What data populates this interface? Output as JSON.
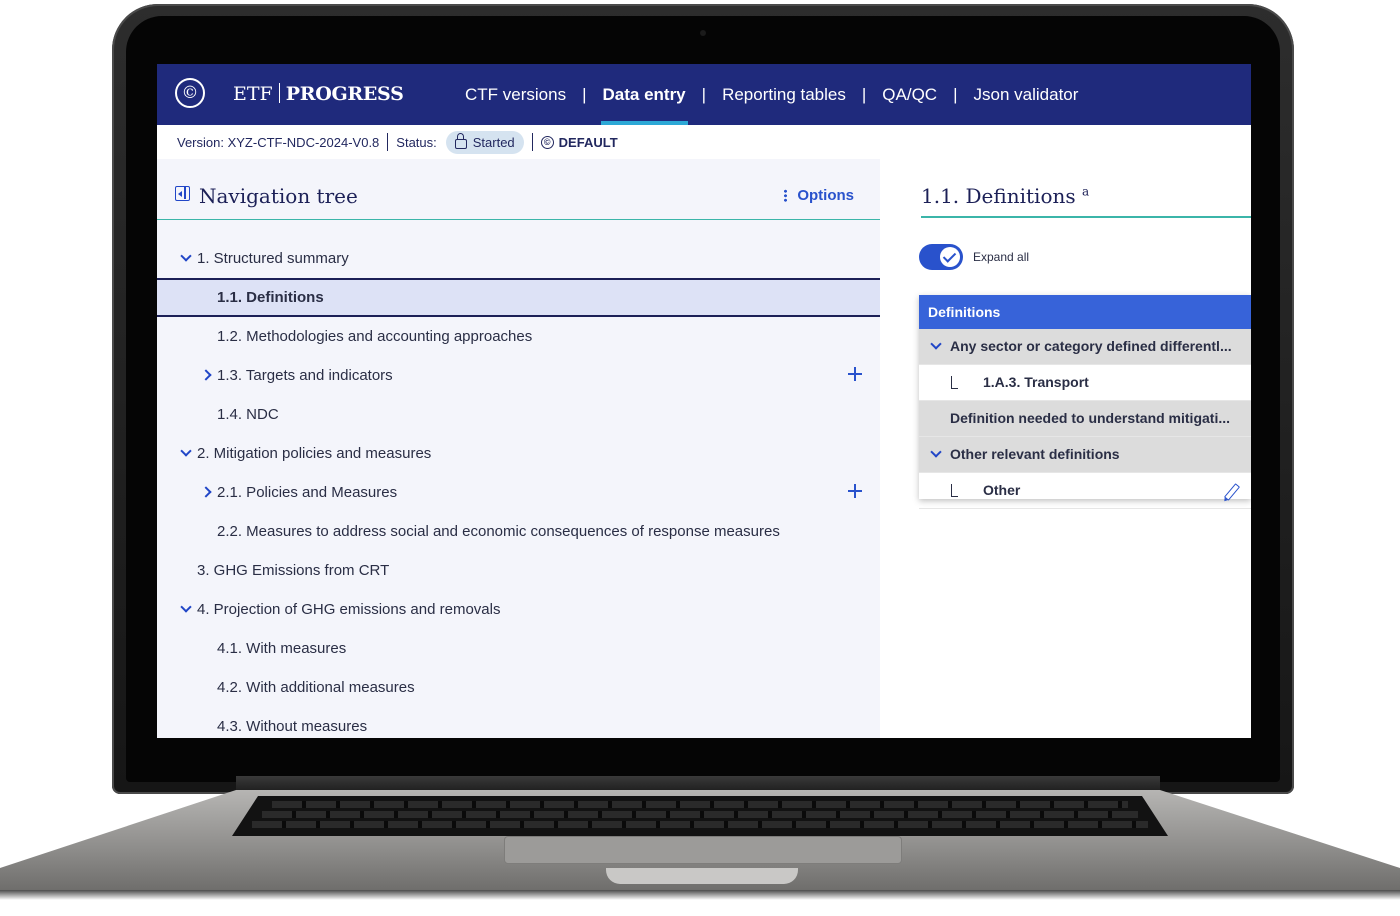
{
  "app": {
    "brand_etf": "ETF",
    "brand_progress": "PROGRESS",
    "logo_glyph": "©"
  },
  "nav": {
    "items": [
      "CTF versions",
      "Data entry",
      "Reporting tables",
      "QA/QC",
      "Json validator"
    ],
    "active": "Data entry",
    "separator": "|"
  },
  "status": {
    "version": "Version: XYZ-CTF-NDC-2024-V0.8",
    "status_label": "Status:",
    "status_value": "Started",
    "default_label": "DEFAULT"
  },
  "tree_panel": {
    "title": "Navigation tree",
    "options": "Options",
    "items": [
      {
        "label": "1.  Structured summary",
        "level": 0,
        "expand": "down"
      },
      {
        "label": "1.1. Definitions",
        "level": 1,
        "selected": true
      },
      {
        "label": "1.2. Methodologies and accounting approaches",
        "level": 1
      },
      {
        "label": "1.3. Targets and indicators",
        "level": 1,
        "expand": "right",
        "plus": true
      },
      {
        "label": "1.4. NDC",
        "level": 1
      },
      {
        "label": "2.  Mitigation policies and measures",
        "level": 0,
        "expand": "down"
      },
      {
        "label": "2.1. Policies and Measures",
        "level": 1,
        "expand": "right",
        "plus": true
      },
      {
        "label": "2.2. Measures to address social and economic consequences of response measures",
        "level": 1
      },
      {
        "label": "3.  GHG Emissions from CRT",
        "level": 0
      },
      {
        "label": "4.  Projection of GHG emissions and removals",
        "level": 0,
        "expand": "down"
      },
      {
        "label": "4.1. With measures",
        "level": 1
      },
      {
        "label": "4.2. With additional measures",
        "level": 1
      },
      {
        "label": "4.3. Without measures",
        "level": 1
      }
    ]
  },
  "detail": {
    "title": "1.1. Definitions",
    "title_sup": "a",
    "expand_all": "Expand all",
    "expand_all_on": true,
    "table_header": "Definitions",
    "rows": [
      {
        "label": "Any sector or category defined differentl...",
        "type": "group",
        "chevron": true
      },
      {
        "label": "1.A.3. Transport",
        "type": "child"
      },
      {
        "label": "Definition needed to understand mitigati...",
        "type": "group"
      },
      {
        "label": "Other relevant definitions",
        "type": "group",
        "chevron": true
      },
      {
        "label": "Other",
        "type": "child",
        "editable": true
      }
    ]
  },
  "colors": {
    "topbar": "#1f2a7c",
    "accent": "#2952cc",
    "active_underline": "#2ca8d6",
    "divider": "#3bb5a9",
    "table_header": "#3763d9"
  }
}
